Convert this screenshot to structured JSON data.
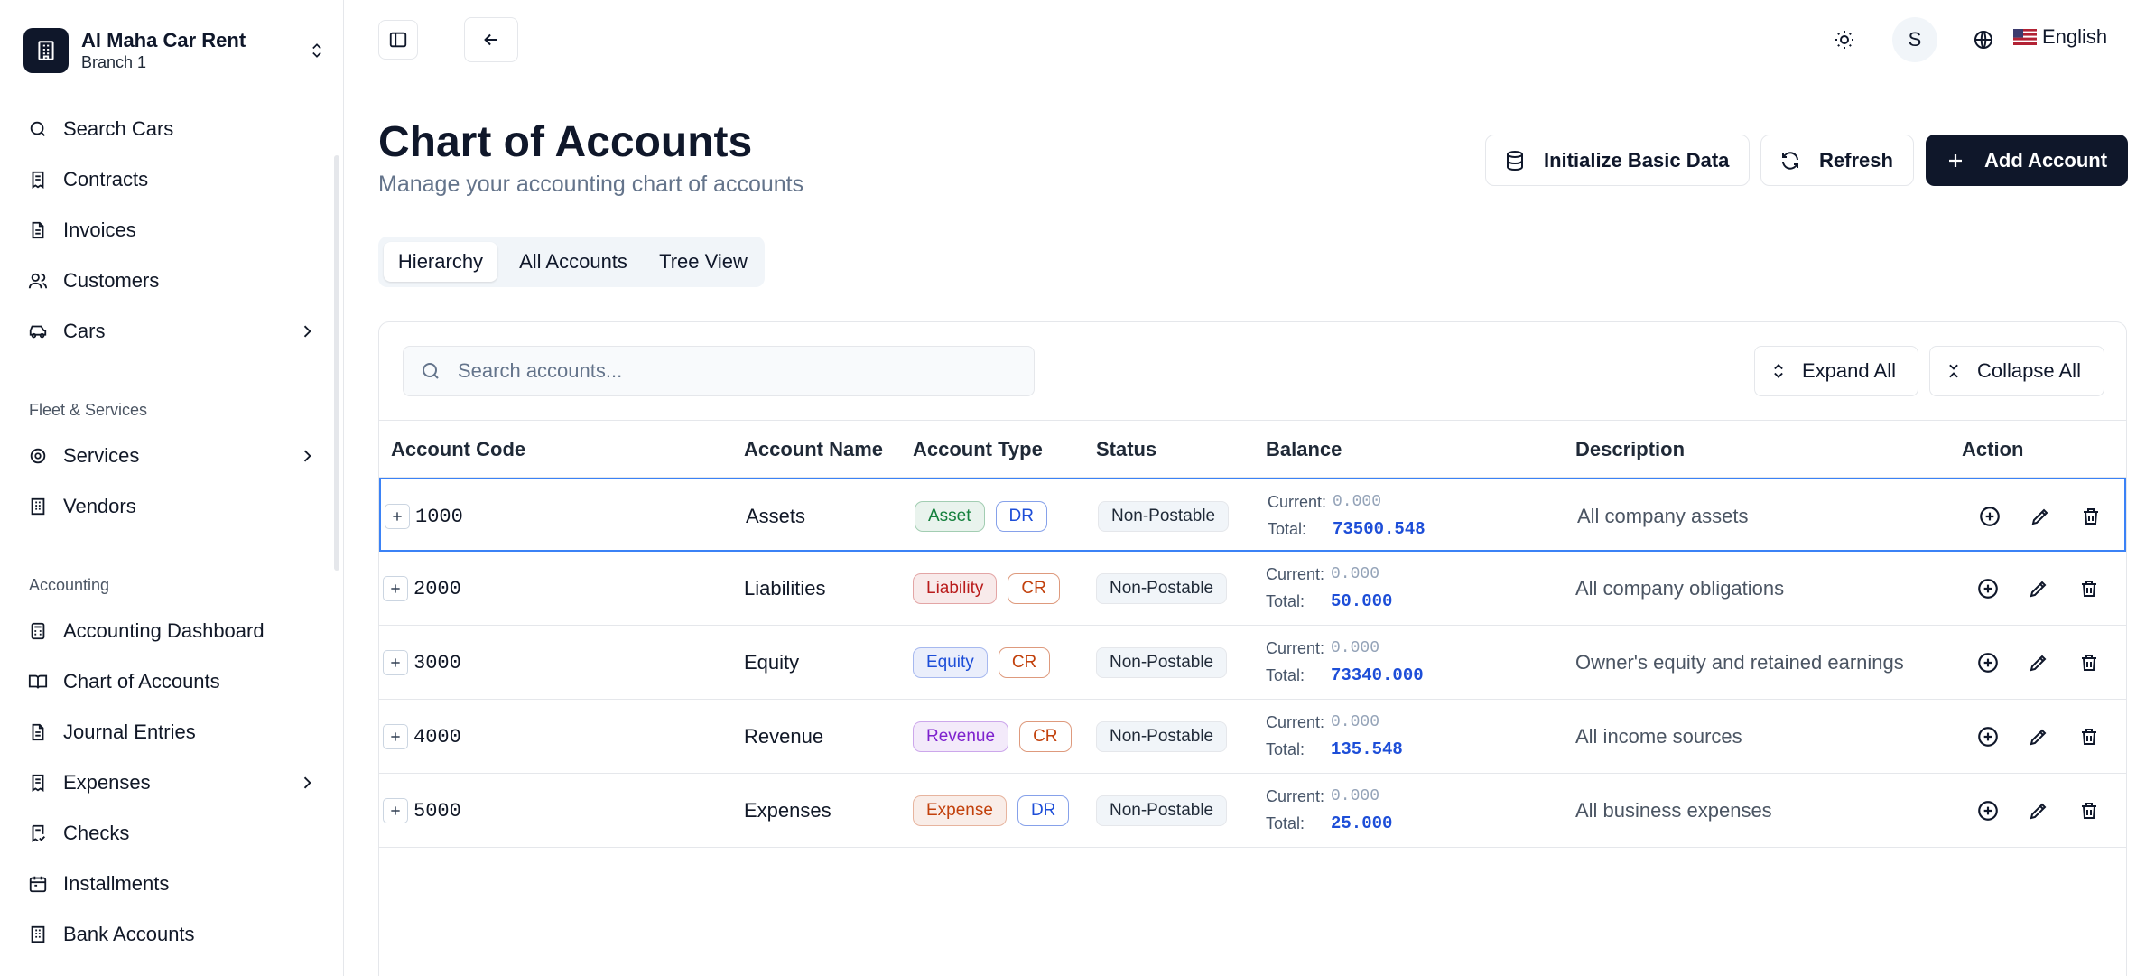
{
  "org": {
    "name": "Al Maha Car Rent",
    "branch": "Branch 1"
  },
  "nav": {
    "items_top": [
      {
        "label": "Search Cars",
        "icon": "search-icon"
      },
      {
        "label": "Contracts",
        "icon": "receipt-icon"
      },
      {
        "label": "Invoices",
        "icon": "file-icon"
      },
      {
        "label": "Customers",
        "icon": "users-icon"
      },
      {
        "label": "Cars",
        "icon": "car-icon"
      }
    ],
    "section_fleet": "Fleet & Services",
    "items_fleet": [
      {
        "label": "Services",
        "icon": "gear-icon"
      },
      {
        "label": "Vendors",
        "icon": "building-icon"
      }
    ],
    "section_accounting": "Accounting",
    "items_accounting": [
      {
        "label": "Accounting Dashboard",
        "icon": "calculator-icon"
      },
      {
        "label": "Chart of Accounts",
        "icon": "book-icon"
      },
      {
        "label": "Journal Entries",
        "icon": "file-icon"
      },
      {
        "label": "Expenses",
        "icon": "receipt-icon"
      },
      {
        "label": "Checks",
        "icon": "check-receipt-icon"
      },
      {
        "label": "Installments",
        "icon": "calendar-icon"
      },
      {
        "label": "Bank Accounts",
        "icon": "building-icon"
      }
    ]
  },
  "topbar": {
    "avatar_initial": "S",
    "language": "English"
  },
  "header": {
    "title": "Chart of Accounts",
    "subtitle": "Manage your accounting chart of accounts",
    "init_label": "Initialize Basic Data",
    "refresh_label": "Refresh",
    "add_label": "Add Account"
  },
  "tabs": [
    "Hierarchy",
    "All Accounts",
    "Tree View"
  ],
  "search": {
    "placeholder": "Search accounts..."
  },
  "controls": {
    "expand_label": "Expand All",
    "collapse_label": "Collapse All"
  },
  "table": {
    "columns": [
      "Account Code",
      "Account Name",
      "Account Type",
      "Status",
      "Balance",
      "Description",
      "Action"
    ],
    "current_label": "Current:",
    "total_label": "Total:",
    "rows": [
      {
        "code": "1000",
        "name": "Assets",
        "type": "Asset",
        "side": "DR",
        "status": "Non-Postable",
        "current": "0.000",
        "total": "73500.548",
        "description": "All company assets"
      },
      {
        "code": "2000",
        "name": "Liabilities",
        "type": "Liability",
        "side": "CR",
        "status": "Non-Postable",
        "current": "0.000",
        "total": "50.000",
        "description": "All company obligations"
      },
      {
        "code": "3000",
        "name": "Equity",
        "type": "Equity",
        "side": "CR",
        "status": "Non-Postable",
        "current": "0.000",
        "total": "73340.000",
        "description": "Owner's equity and retained earnings"
      },
      {
        "code": "4000",
        "name": "Revenue",
        "type": "Revenue",
        "side": "CR",
        "status": "Non-Postable",
        "current": "0.000",
        "total": "135.548",
        "description": "All income sources"
      },
      {
        "code": "5000",
        "name": "Expenses",
        "type": "Expense",
        "side": "DR",
        "status": "Non-Postable",
        "current": "0.000",
        "total": "25.000",
        "description": "All business expenses"
      }
    ]
  },
  "colors": {
    "primary": "#0f172a",
    "selection": "#3b82f6",
    "asset": "#15803d",
    "liability": "#b91c1c",
    "equity": "#1d4ed8",
    "revenue": "#7e22ce",
    "expense": "#c2410c",
    "dr": "#1d4ed8",
    "cr": "#c2410c"
  }
}
